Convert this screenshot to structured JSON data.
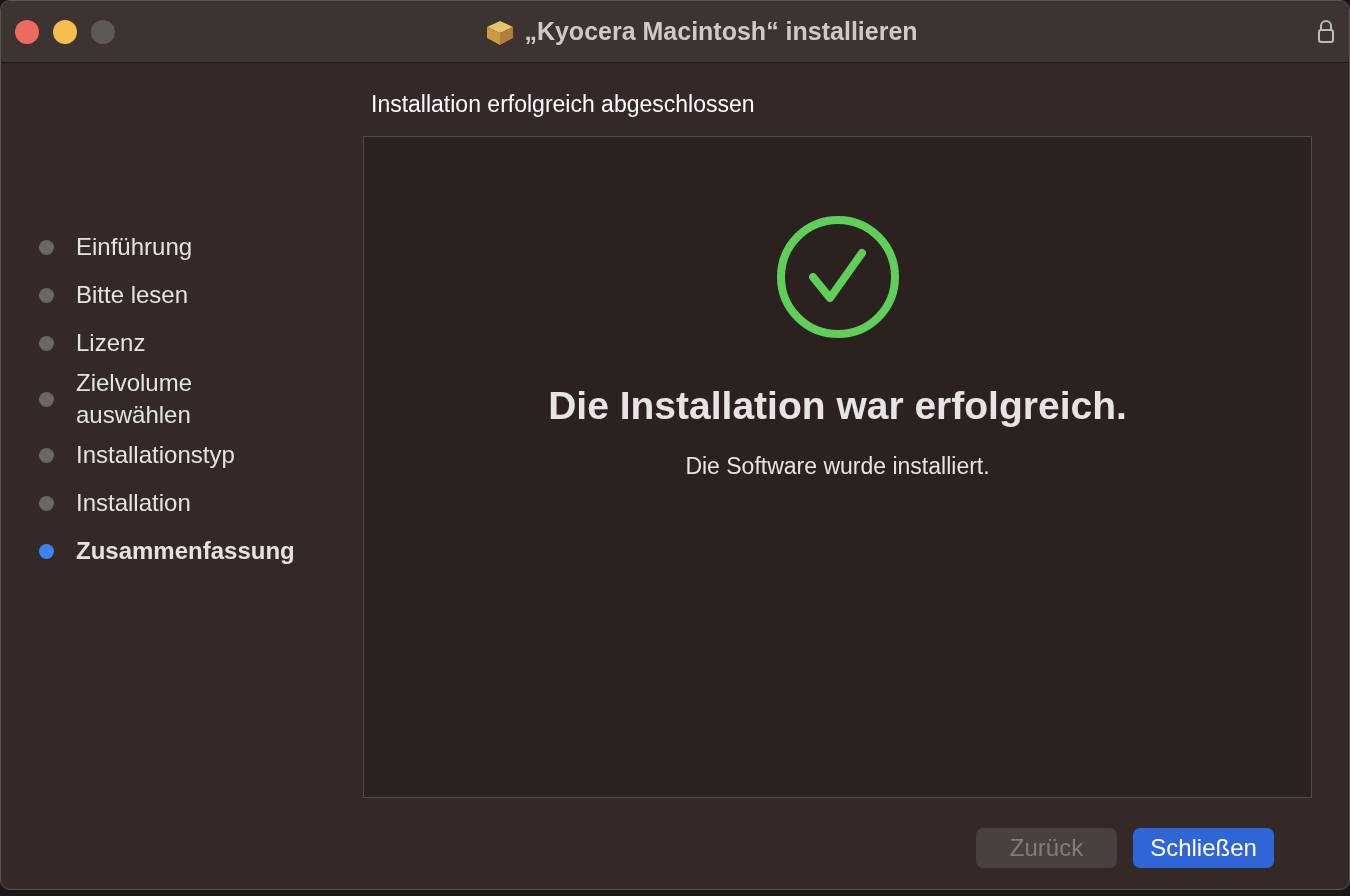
{
  "window": {
    "title": "„Kyocera Macintosh“ installieren"
  },
  "steps": [
    {
      "label": "Einführung",
      "selected": false
    },
    {
      "label": "Bitte lesen",
      "selected": false
    },
    {
      "label": "Lizenz",
      "selected": false
    },
    {
      "label": "Zielvolume auswählen",
      "selected": false
    },
    {
      "label": "Installationstyp",
      "selected": false
    },
    {
      "label": "Installation",
      "selected": false
    },
    {
      "label": "Zusammenfassung",
      "selected": true
    }
  ],
  "page_title": "Installation erfolgreich abgeschlossen",
  "result": {
    "heading": "Die Installation war erfolgreich.",
    "message": "Die Software wurde installiert."
  },
  "buttons": [
    {
      "label": "Zurück",
      "disabled": true,
      "primary": false
    },
    {
      "label": "Schließen",
      "disabled": false,
      "primary": true
    }
  ]
}
